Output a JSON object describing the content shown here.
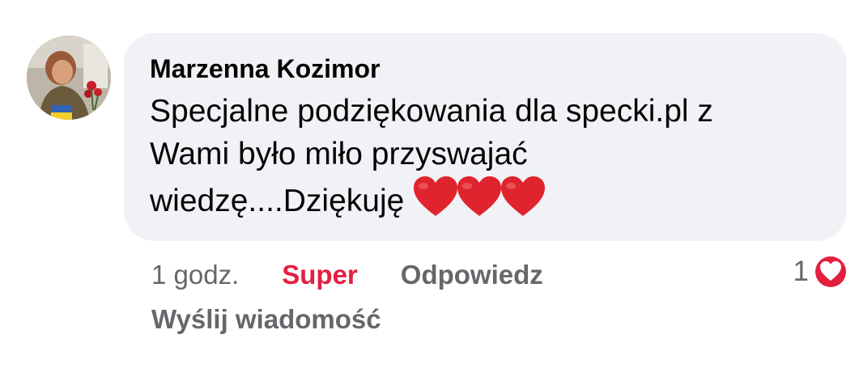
{
  "comment": {
    "author": "Marzenna Kozimor",
    "text": "Specjalne podziękowania dla specki.pl z\nWami było miło przyswajać\nwiedzę....Dziękuję",
    "emoji": [
      "heart-emoji",
      "heart-emoji",
      "heart-emoji"
    ],
    "timestamp": "1 godz.",
    "reaction_label": "Super",
    "reply_label": "Odpowiedz",
    "reaction_count": "1",
    "reaction_icon": "love-reaction-icon",
    "message_label": "Wyślij wiadomość"
  },
  "colors": {
    "bubble": "#f0f2f5",
    "author": "#050505",
    "secondary_text": "#65676b",
    "love_red": "#e41e3f",
    "heart_emoji": "#e0242e"
  }
}
